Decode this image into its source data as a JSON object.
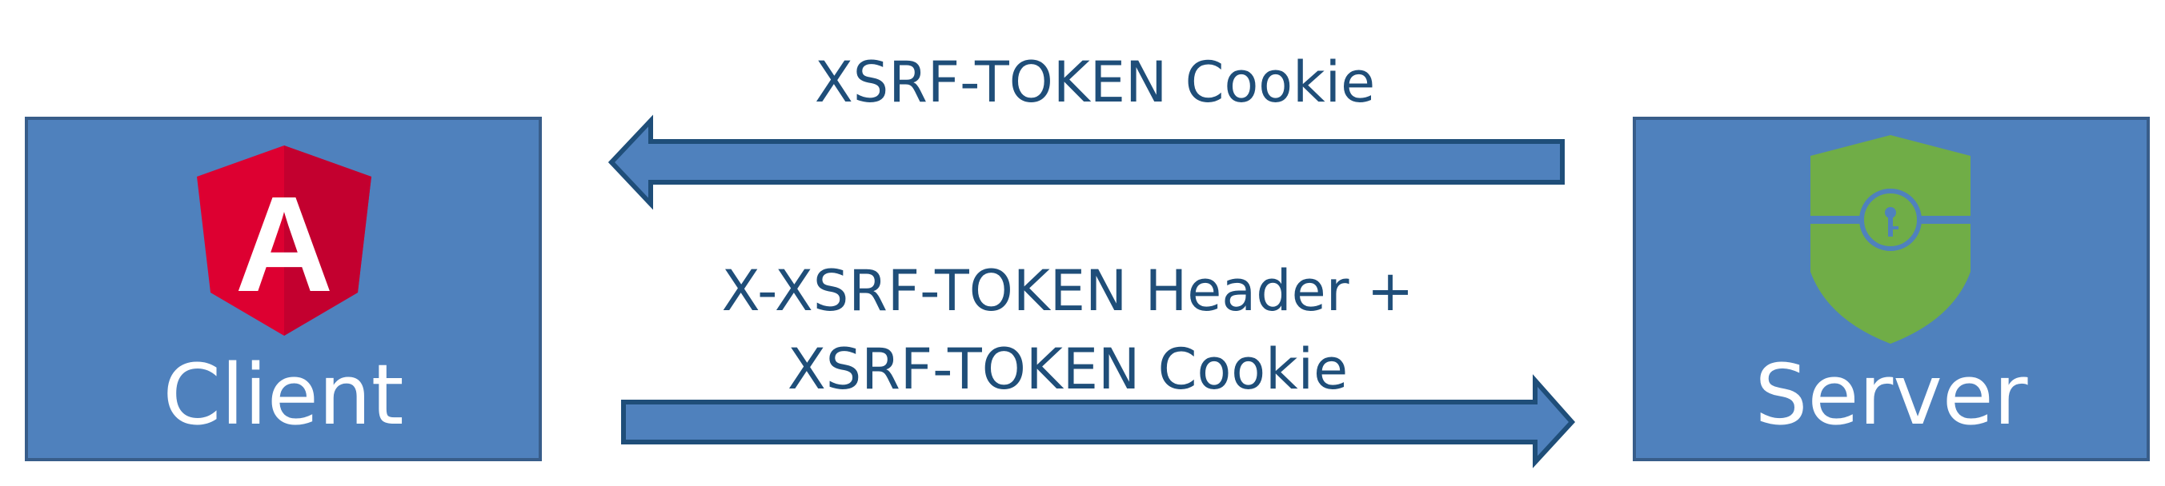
{
  "client": {
    "label": "Client",
    "icon": "angular-logo-icon",
    "icon_letter": "A"
  },
  "server": {
    "label": "Server",
    "icon": "shield-lock-icon"
  },
  "arrow_to_client": {
    "label": "XSRF-TOKEN Cookie"
  },
  "arrow_to_server": {
    "label_line1": "X-XSRF-TOKEN Header +",
    "label_line2": "XSRF-TOKEN Cookie"
  },
  "colors": {
    "box_fill": "#4f81bd",
    "box_stroke": "#385d8a",
    "label_text": "#1f4e79",
    "angular_red": "#dd0031",
    "angular_dark_red": "#c3002f",
    "shield_green": "#70ad47"
  }
}
